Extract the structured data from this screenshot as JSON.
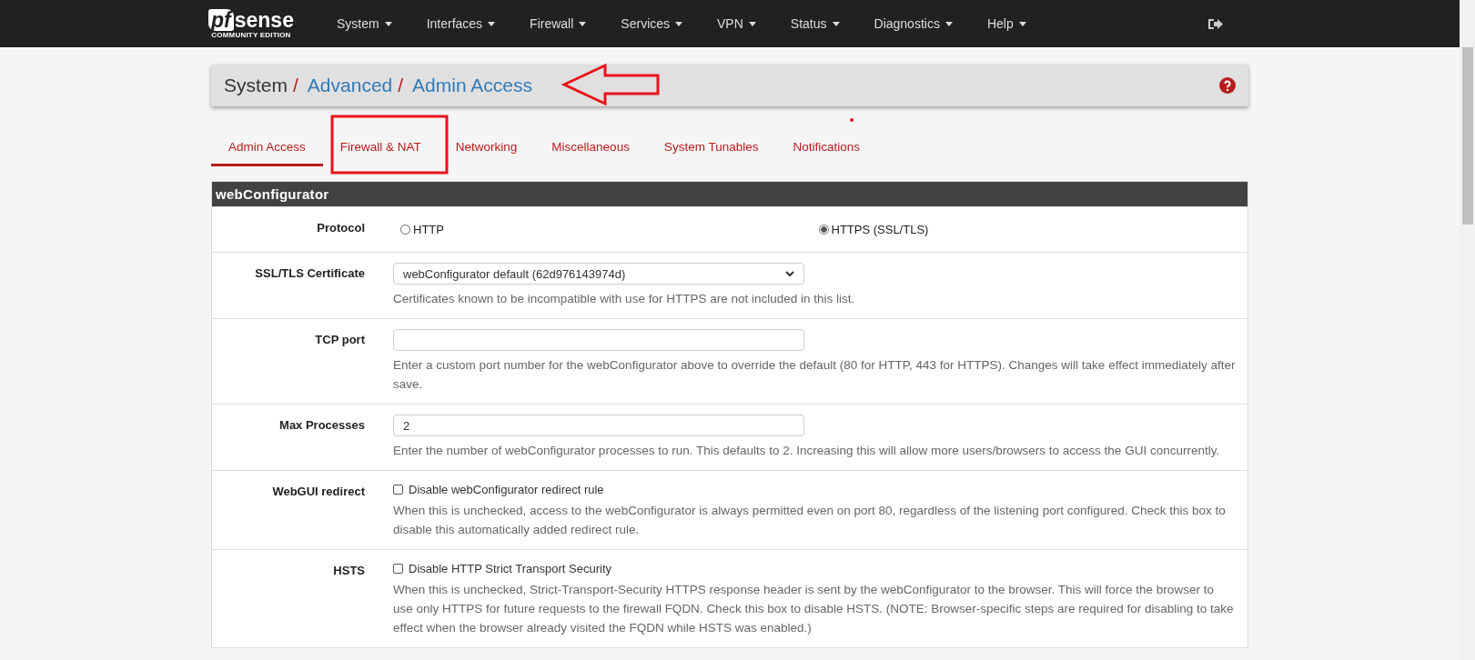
{
  "navbar": {
    "logo": {
      "brand_left": "pf",
      "brand_right": "sense",
      "edition": "COMMUNITY EDITION"
    },
    "menu": [
      {
        "label": "System"
      },
      {
        "label": "Interfaces"
      },
      {
        "label": "Firewall"
      },
      {
        "label": "Services"
      },
      {
        "label": "VPN"
      },
      {
        "label": "Status"
      },
      {
        "label": "Diagnostics"
      },
      {
        "label": "Help"
      }
    ]
  },
  "breadcrumb": [
    {
      "kind": "text",
      "label": "System"
    },
    {
      "kind": "separator",
      "label": "/"
    },
    {
      "kind": "link",
      "label": "Advanced"
    },
    {
      "kind": "separator",
      "label": "/"
    },
    {
      "kind": "link",
      "label": "Admin Access"
    }
  ],
  "tabs": [
    {
      "label": "Admin Access",
      "selected": true
    },
    {
      "label": "Firewall & NAT",
      "selected": false
    },
    {
      "label": "Networking",
      "selected": false
    },
    {
      "label": "Miscellaneous",
      "selected": false
    },
    {
      "label": "System Tunables",
      "selected": false
    },
    {
      "label": "Notifications",
      "selected": false
    }
  ],
  "panel": {
    "title": "webConfigurator",
    "rows": [
      {
        "kind": "radio",
        "label": "Protocol",
        "options": [
          {
            "label": "HTTP",
            "selected": false
          },
          {
            "label": "HTTPS (SSL/TLS)",
            "selected": true
          }
        ]
      },
      {
        "kind": "select",
        "label": "SSL/TLS Certificate",
        "value": "webConfigurator default (62d976143974d)",
        "help": "Certificates known to be incompatible with use for HTTPS are not included in this list."
      },
      {
        "kind": "text",
        "label": "TCP port",
        "value": "",
        "help": "Enter a custom port number for the webConfigurator above to override the default (80 for HTTP, 443 for HTTPS). Changes will take effect immediately after save."
      },
      {
        "kind": "text",
        "label": "Max Processes",
        "value": "2",
        "help": "Enter the number of webConfigurator processes to run. This defaults to 2. Increasing this will allow more users/browsers to access the GUI concurrently."
      },
      {
        "kind": "checkbox",
        "label": "WebGUI redirect",
        "option": "Disable webConfigurator redirect rule",
        "checked": false,
        "help": "When this is unchecked, access to the webConfigurator is always permitted even on port 80, regardless of the listening port configured. Check this box to disable this automatically added redirect rule."
      },
      {
        "kind": "checkbox",
        "label": "HSTS",
        "option": "Disable HTTP Strict Transport Security",
        "checked": false,
        "help": "When this is unchecked, Strict-Transport-Security HTTPS response header is sent by the webConfigurator to the browser. This will force the browser to use only HTTPS for future requests to the firewall FQDN. Check this box to disable HSTS. (NOTE: Browser-specific steps are required for disabling to take effect when the browser already visited the FQDN while HSTS was enabled.)"
      }
    ]
  }
}
